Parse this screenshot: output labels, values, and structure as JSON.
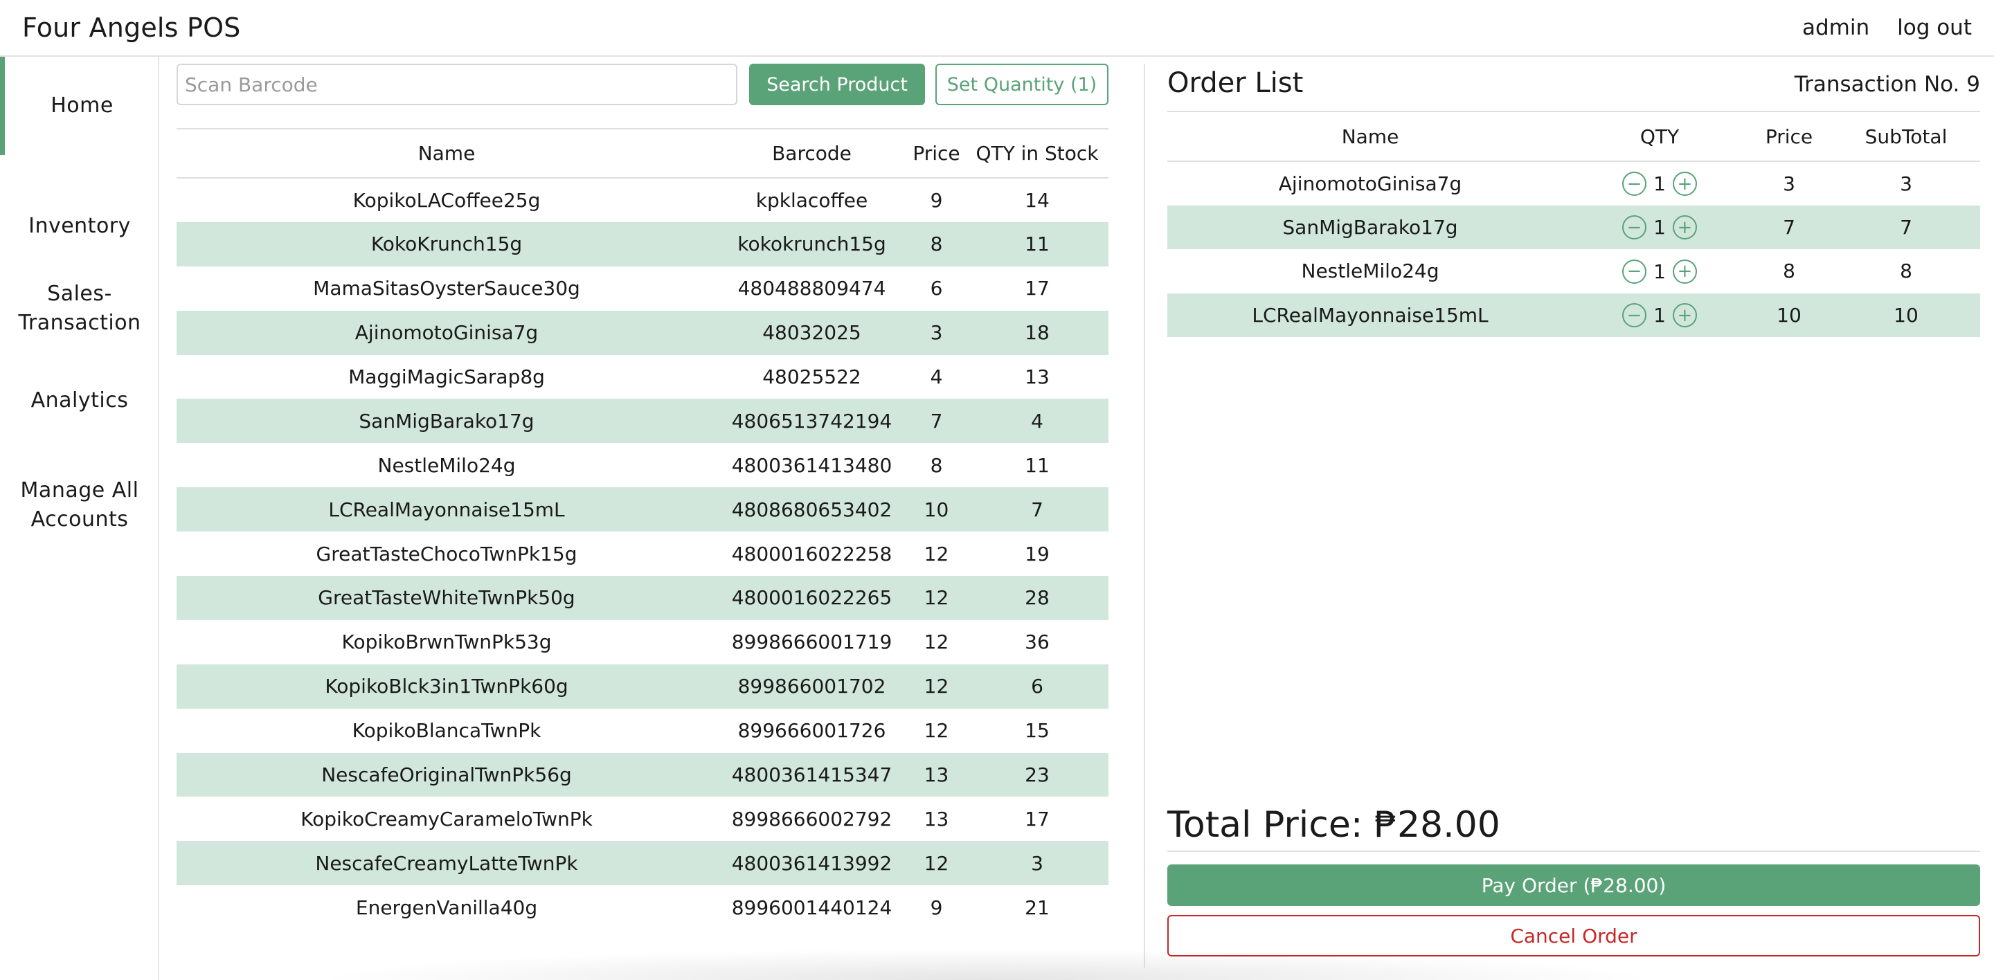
{
  "app": {
    "title": "Four Angels POS"
  },
  "header": {
    "user": "admin",
    "logout": "log out"
  },
  "sidebar": {
    "items": [
      {
        "label": "Home",
        "active": true
      },
      {
        "label": "Inventory"
      },
      {
        "label": "Sales-\nTransaction"
      },
      {
        "label": "Analytics"
      },
      {
        "label": "Manage All\nAccounts"
      }
    ]
  },
  "search": {
    "placeholder": "Scan Barcode",
    "value": "",
    "search_button": "Search Product",
    "set_quantity_button": "Set Quantity (1)"
  },
  "inventory": {
    "columns": [
      "Name",
      "Barcode",
      "Price",
      "QTY in Stock"
    ],
    "rows": [
      [
        "KopikoLACoffee25g",
        "kpklacoffee",
        "9",
        "14"
      ],
      [
        "KokoKrunch15g",
        "kokokrunch15g",
        "8",
        "11"
      ],
      [
        "MamaSitasOysterSauce30g",
        "480488809474",
        "6",
        "17"
      ],
      [
        "AjinomotoGinisa7g",
        "48032025",
        "3",
        "18"
      ],
      [
        "MaggiMagicSarap8g",
        "48025522",
        "4",
        "13"
      ],
      [
        "SanMigBarako17g",
        "4806513742194",
        "7",
        "4"
      ],
      [
        "NestleMilo24g",
        "4800361413480",
        "8",
        "11"
      ],
      [
        "LCRealMayonnaise15mL",
        "4808680653402",
        "10",
        "7"
      ],
      [
        "GreatTasteChocoTwnPk15g",
        "4800016022258",
        "12",
        "19"
      ],
      [
        "GreatTasteWhiteTwnPk50g",
        "4800016022265",
        "12",
        "28"
      ],
      [
        "KopikoBrwnTwnPk53g",
        "8998666001719",
        "12",
        "36"
      ],
      [
        "KopikoBlck3in1TwnPk60g",
        "899866001702",
        "12",
        "6"
      ],
      [
        "KopikoBlancaTwnPk",
        "899666001726",
        "12",
        "15"
      ],
      [
        "NescafeOriginalTwnPk56g",
        "4800361415347",
        "13",
        "23"
      ],
      [
        "KopikoCreamyCarameloTwnPk",
        "8998666002792",
        "13",
        "17"
      ],
      [
        "NescafeCreamyLatteTwnPk",
        "4800361413992",
        "12",
        "3"
      ],
      [
        "EnergenVanilla40g",
        "8996001440124",
        "9",
        "21"
      ]
    ]
  },
  "order": {
    "title": "Order List",
    "transaction": "Transaction No. 9",
    "columns": [
      "Name",
      "QTY",
      "Price",
      "SubTotal"
    ],
    "rows": [
      {
        "name": "AjinomotoGinisa7g",
        "qty": "1",
        "price": "3",
        "subtotal": "3"
      },
      {
        "name": "SanMigBarako17g",
        "qty": "1",
        "price": "7",
        "subtotal": "7"
      },
      {
        "name": "NestleMilo24g",
        "qty": "1",
        "price": "8",
        "subtotal": "8"
      },
      {
        "name": "LCRealMayonnaise15mL",
        "qty": "1",
        "price": "10",
        "subtotal": "10"
      }
    ],
    "total_label": "Total Price: ₱28.00",
    "pay_button": "Pay Order (₱28.00)",
    "cancel_button": "Cancel Order"
  },
  "icons": {
    "minus": "minus-circle-icon",
    "plus": "plus-circle-icon"
  },
  "colors": {
    "accent": "#5aa277",
    "row_alt": "#d1e7dc",
    "danger": "#c62828"
  }
}
